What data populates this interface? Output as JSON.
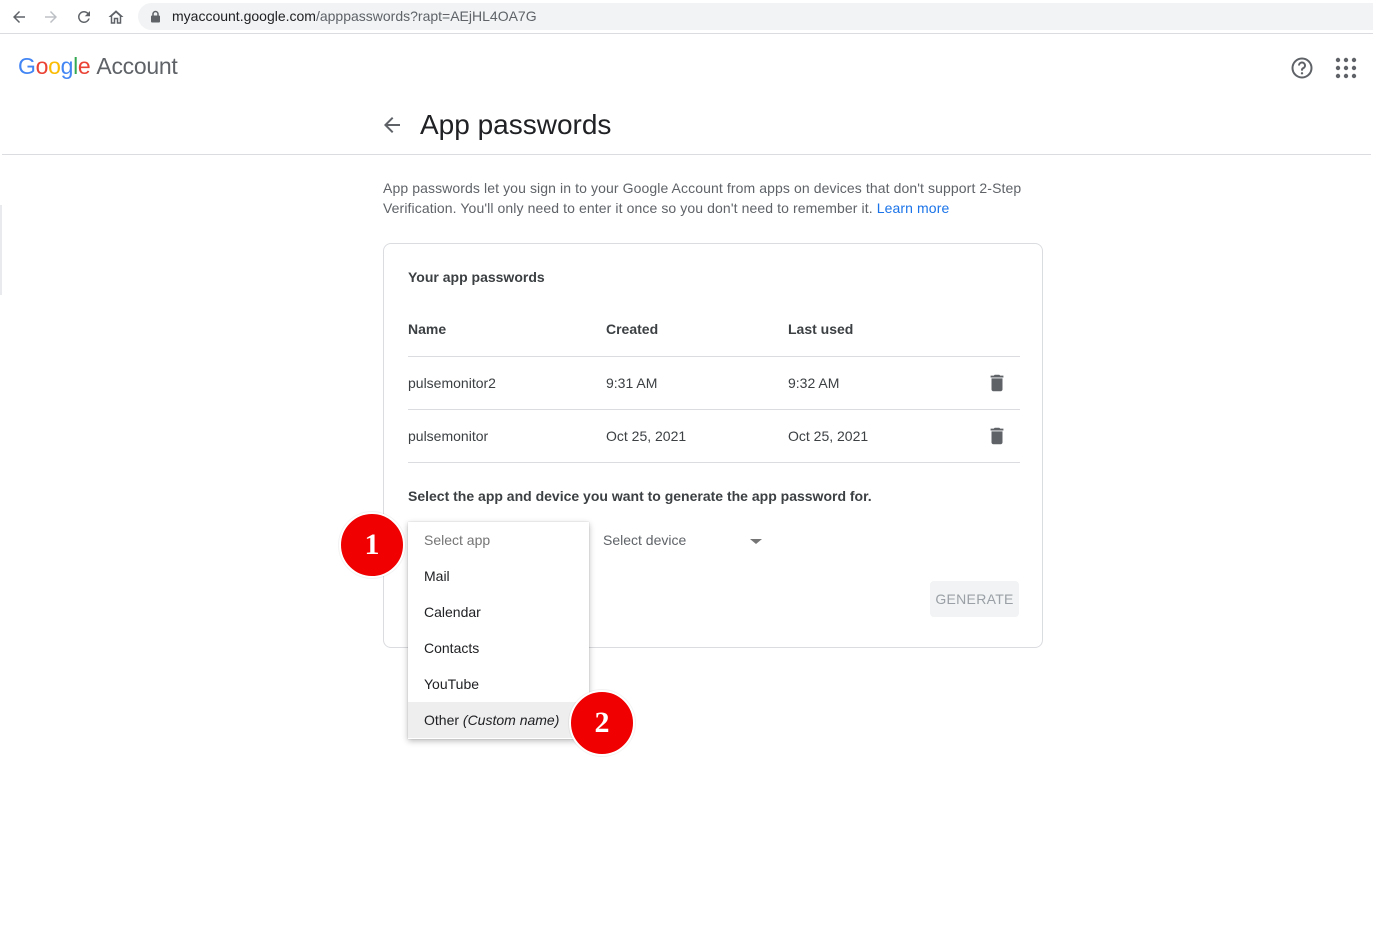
{
  "browser": {
    "url_host": "myaccount.google.com",
    "url_path": "/apppasswords?rapt=AEjHL4OA7G"
  },
  "header": {
    "logo_google": [
      "G",
      "o",
      "o",
      "g",
      "l",
      "e"
    ],
    "logo_suffix": "Account",
    "colors": {
      "blue": "#4285f4",
      "red": "#ea4335",
      "yellow": "#fbbc05",
      "green": "#34a853"
    }
  },
  "page": {
    "title": "App passwords",
    "intro_text": "App passwords let you sign in to your Google Account from apps on devices that don't support 2-Step Verification. You'll only need to enter it once so you don't need to remember it.",
    "learn_more": "Learn more"
  },
  "card": {
    "title": "Your app passwords",
    "columns": [
      "Name",
      "Created",
      "Last used"
    ],
    "rows": [
      {
        "name": "pulsemonitor2",
        "created": "9:31 AM",
        "last_used": "9:32 AM"
      },
      {
        "name": "pulsemonitor",
        "created": "Oct 25, 2021",
        "last_used": "Oct 25, 2021"
      }
    ],
    "select_prompt": "Select the app and device you want to generate the app password for.",
    "device_select": "Select device",
    "generate_label": "GENERATE"
  },
  "app_dropdown": {
    "placeholder": "Select app",
    "options": [
      "Mail",
      "Calendar",
      "Contacts",
      "YouTube"
    ],
    "other_label": "Other",
    "other_hint": "(Custom name)",
    "highlighted": "Other"
  },
  "markers": [
    "1",
    "2"
  ],
  "accent_colors": {
    "link": "#1a73e8",
    "marker": "#f00000"
  }
}
